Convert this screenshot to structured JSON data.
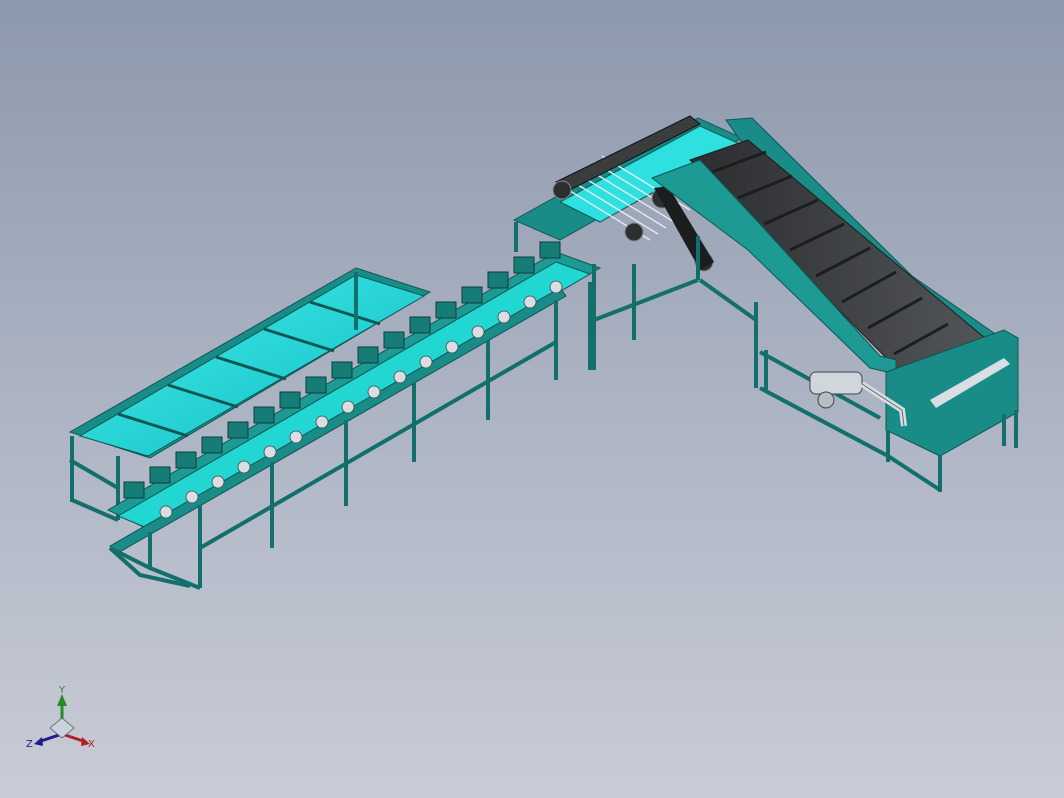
{
  "viewport": {
    "background_top": "#8c98ac",
    "background_bottom": "#c9ccd6"
  },
  "model": {
    "frame_color": "#1f8f8a",
    "frame_dark": "#0d5753",
    "tray_color": "#19d9d9",
    "belt_color": "#3d3f41",
    "belt_edge": "#1c1d1e",
    "roller_color": "#d8dee4"
  },
  "triad": {
    "y_label": "Y",
    "x_label": "X",
    "z_label": "Z",
    "y_color": "#2a8a2a",
    "x_color": "#b02020",
    "z_color": "#1d1d8a"
  }
}
